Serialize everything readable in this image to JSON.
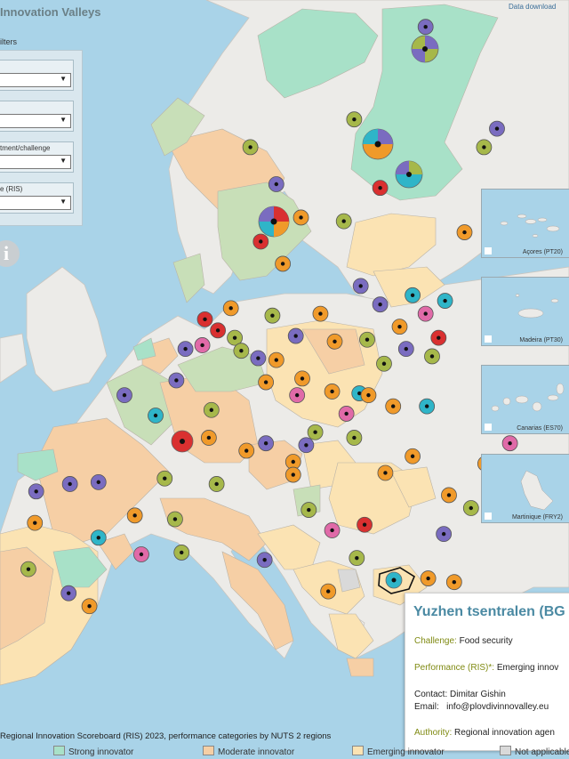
{
  "title": "Innovation Valleys",
  "data_download": "Data download",
  "filters": {
    "label": "ilters",
    "items": [
      {
        "label": "",
        "value": ""
      },
      {
        "label": "",
        "value": ""
      },
      {
        "label": "tment/challenge",
        "value": ""
      },
      {
        "label": "e (RIS)",
        "value": ""
      }
    ]
  },
  "info_icon": "i",
  "insets": [
    "Açores (PT20)",
    "Madeira (PT30)",
    "Canarias (ES70)",
    "Martinique (FRY2)"
  ],
  "tooltip": {
    "title": "Yuzhen tsentralen (BG",
    "challenge_key": "Challenge:",
    "challenge_val": "Food security",
    "performance_key": "Performance (RIS)*:",
    "performance_val": "Emerging innov",
    "contact_key": "Contact:",
    "contact_val": "Dimitar Gishin",
    "email_key": "Email:",
    "email_val": "info@plovdivinnovalley.eu",
    "authority_key": "Authority:",
    "authority_val": "Regional innovation agen"
  },
  "legend": {
    "title": "Regional Innovation Scoreboard (RIS) 2023, performance categories by NUTS 2 regions",
    "items": [
      {
        "label": "Strong innovator",
        "color": "#a8e1c8"
      },
      {
        "label": "Moderate innovator",
        "color": "#f6cfa5"
      },
      {
        "label": "Emerging innovator",
        "color": "#fbe3b3"
      },
      {
        "label": "Not applicable",
        "color": "#d9d9d9"
      }
    ]
  },
  "colors": {
    "sea": "#a9d3e8",
    "land": "#ecebe8",
    "strong": "#a8e1c8",
    "moderate": "#f6cfa5",
    "emerging": "#fbe3b3",
    "leader": "#c8dfb8",
    "marker_purple": "#7a6cc0",
    "marker_olive": "#a6b84a",
    "marker_orange": "#f09a2a",
    "marker_red": "#d93030",
    "marker_teal": "#2fb5c8",
    "marker_pink": "#e06aa8"
  },
  "markers": [
    {
      "lon": 21.5,
      "lat": 68.0,
      "color": "purple"
    },
    {
      "lon": 16.0,
      "lat": 63.0,
      "color": "olive"
    },
    {
      "lon": 8.0,
      "lat": 61.5,
      "color": "olive"
    },
    {
      "lon": 10.0,
      "lat": 59.5,
      "color": "purple"
    },
    {
      "lon": 18.0,
      "lat": 59.3,
      "color": "red"
    },
    {
      "lon": 15.2,
      "lat": 57.5,
      "color": "olive"
    },
    {
      "lon": 11.9,
      "lat": 57.7,
      "color": "orange"
    },
    {
      "lon": 26.5,
      "lat": 58.4,
      "color": "pink"
    },
    {
      "lon": 24.5,
      "lat": 56.9,
      "color": "orange"
    },
    {
      "lon": 26.0,
      "lat": 61.5,
      "color": "olive"
    },
    {
      "lon": 27.0,
      "lat": 62.5,
      "color": "purple"
    },
    {
      "lon": 8.8,
      "lat": 56.4,
      "color": "red"
    },
    {
      "lon": 10.5,
      "lat": 55.2,
      "color": "orange"
    },
    {
      "lon": 16.5,
      "lat": 54.0,
      "color": "purple"
    },
    {
      "lon": 20.5,
      "lat": 53.5,
      "color": "teal"
    },
    {
      "lon": 23.0,
      "lat": 53.2,
      "color": "teal"
    },
    {
      "lon": 18.0,
      "lat": 53.0,
      "color": "purple"
    },
    {
      "lon": 21.5,
      "lat": 52.5,
      "color": "pink"
    },
    {
      "lon": 19.5,
      "lat": 51.8,
      "color": "orange"
    },
    {
      "lon": 22.5,
      "lat": 51.2,
      "color": "red"
    },
    {
      "lon": 17.0,
      "lat": 51.1,
      "color": "olive"
    },
    {
      "lon": 20.0,
      "lat": 50.6,
      "color": "purple"
    },
    {
      "lon": 22.0,
      "lat": 50.2,
      "color": "olive"
    },
    {
      "lon": 4.5,
      "lat": 52.2,
      "color": "red"
    },
    {
      "lon": 6.5,
      "lat": 52.8,
      "color": "orange"
    },
    {
      "lon": 5.5,
      "lat": 51.6,
      "color": "red"
    },
    {
      "lon": 4.3,
      "lat": 50.8,
      "color": "pink"
    },
    {
      "lon": 3.0,
      "lat": 50.6,
      "color": "purple"
    },
    {
      "lon": 6.8,
      "lat": 51.2,
      "color": "olive"
    },
    {
      "lon": 7.3,
      "lat": 50.5,
      "color": "olive"
    },
    {
      "lon": 8.6,
      "lat": 50.1,
      "color": "purple"
    },
    {
      "lon": 9.7,
      "lat": 52.4,
      "color": "olive"
    },
    {
      "lon": 11.5,
      "lat": 51.3,
      "color": "purple"
    },
    {
      "lon": 13.4,
      "lat": 52.5,
      "color": "orange"
    },
    {
      "lon": 14.5,
      "lat": 51.0,
      "color": "orange"
    },
    {
      "lon": 12.0,
      "lat": 49.0,
      "color": "orange"
    },
    {
      "lon": 9.2,
      "lat": 48.8,
      "color": "orange"
    },
    {
      "lon": 11.6,
      "lat": 48.1,
      "color": "pink"
    },
    {
      "lon": 10.0,
      "lat": 50.0,
      "color": "orange"
    },
    {
      "lon": 16.4,
      "lat": 48.2,
      "color": "teal"
    },
    {
      "lon": 14.3,
      "lat": 48.3,
      "color": "orange"
    },
    {
      "lon": 15.4,
      "lat": 47.1,
      "color": "pink"
    },
    {
      "lon": 17.1,
      "lat": 48.1,
      "color": "orange"
    },
    {
      "lon": 19.0,
      "lat": 47.5,
      "color": "orange"
    },
    {
      "lon": 21.6,
      "lat": 47.5,
      "color": "teal"
    },
    {
      "lon": 18.3,
      "lat": 49.8,
      "color": "olive"
    },
    {
      "lon": 2.3,
      "lat": 48.9,
      "color": "purple"
    },
    {
      "lon": -1.7,
      "lat": 48.1,
      "color": "purple"
    },
    {
      "lon": 0.7,
      "lat": 47.0,
      "color": "teal"
    },
    {
      "lon": 5.0,
      "lat": 47.3,
      "color": "olive"
    },
    {
      "lon": 4.8,
      "lat": 45.8,
      "color": "orange"
    },
    {
      "lon": 1.4,
      "lat": 43.6,
      "color": "olive"
    },
    {
      "lon": 5.4,
      "lat": 43.3,
      "color": "olive"
    },
    {
      "lon": 7.7,
      "lat": 45.1,
      "color": "orange"
    },
    {
      "lon": 9.2,
      "lat": 45.5,
      "color": "purple"
    },
    {
      "lon": 11.3,
      "lat": 44.5,
      "color": "orange"
    },
    {
      "lon": 12.3,
      "lat": 45.4,
      "color": "purple"
    },
    {
      "lon": 13.0,
      "lat": 46.1,
      "color": "olive"
    },
    {
      "lon": 11.3,
      "lat": 43.8,
      "color": "orange"
    },
    {
      "lon": 12.5,
      "lat": 41.9,
      "color": "olive"
    },
    {
      "lon": 14.3,
      "lat": 40.8,
      "color": "pink"
    },
    {
      "lon": 16.8,
      "lat": 41.1,
      "color": "red"
    },
    {
      "lon": 16.2,
      "lat": 39.3,
      "color": "olive"
    },
    {
      "lon": 14.0,
      "lat": 37.5,
      "color": "orange"
    },
    {
      "lon": 9.1,
      "lat": 39.2,
      "color": "purple"
    },
    {
      "lon": 16.0,
      "lat": 45.8,
      "color": "olive"
    },
    {
      "lon": 18.4,
      "lat": 43.9,
      "color": "orange"
    },
    {
      "lon": 20.5,
      "lat": 44.8,
      "color": "orange"
    },
    {
      "lon": 23.3,
      "lat": 42.7,
      "color": "orange"
    },
    {
      "lon": 26.1,
      "lat": 44.4,
      "color": "orange"
    },
    {
      "lon": 28.0,
      "lat": 45.5,
      "color": "pink"
    },
    {
      "lon": 22.9,
      "lat": 40.6,
      "color": "purple"
    },
    {
      "lon": 23.7,
      "lat": 38.0,
      "color": "orange"
    },
    {
      "lon": 21.7,
      "lat": 38.2,
      "color": "orange"
    },
    {
      "lon": 25.1,
      "lat": 35.3,
      "color": "orange"
    },
    {
      "lon": -3.7,
      "lat": 40.4,
      "color": "teal"
    },
    {
      "lon": -0.9,
      "lat": 41.6,
      "color": "orange"
    },
    {
      "lon": 2.2,
      "lat": 41.4,
      "color": "olive"
    },
    {
      "lon": -5.9,
      "lat": 43.3,
      "color": "purple"
    },
    {
      "lon": -8.5,
      "lat": 42.9,
      "color": "purple"
    },
    {
      "lon": -0.4,
      "lat": 39.5,
      "color": "pink"
    },
    {
      "lon": -4.4,
      "lat": 36.7,
      "color": "orange"
    },
    {
      "lon": -6.0,
      "lat": 37.4,
      "color": "purple"
    },
    {
      "lon": -9.1,
      "lat": 38.7,
      "color": "olive"
    },
    {
      "lon": -8.6,
      "lat": 41.2,
      "color": "orange"
    },
    {
      "lon": -3.7,
      "lat": 43.4,
      "color": "purple"
    },
    {
      "lon": 2.7,
      "lat": 39.6,
      "color": "olive"
    },
    {
      "lon": 25.0,
      "lat": 42.0,
      "color": "olive"
    }
  ]
}
